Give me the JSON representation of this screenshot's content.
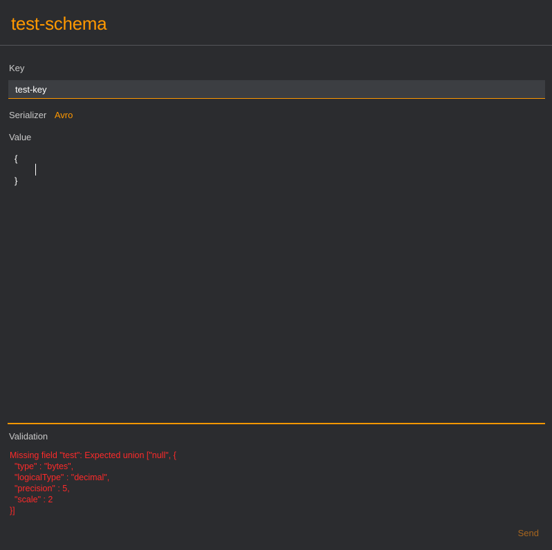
{
  "header": {
    "title": "test-schema"
  },
  "key": {
    "label": "Key",
    "value": "test-key"
  },
  "serializer": {
    "label": "Serializer",
    "value": "Avro"
  },
  "value_editor": {
    "label": "Value",
    "line_1": "{",
    "line_3": "}"
  },
  "validation": {
    "label": "Validation",
    "message": "Missing field \"test\": Expected union [\"null\", {\n  \"type\" : \"bytes\",\n  \"logicalType\" : \"decimal\",\n  \"precision\" : 5,\n  \"scale\" : 2\n}]"
  },
  "actions": {
    "send_label": "Send"
  },
  "colors": {
    "background": "#2b2c2f",
    "accent": "#ff9800",
    "error": "#ff2a2a",
    "input_background": "#3c3e42"
  }
}
